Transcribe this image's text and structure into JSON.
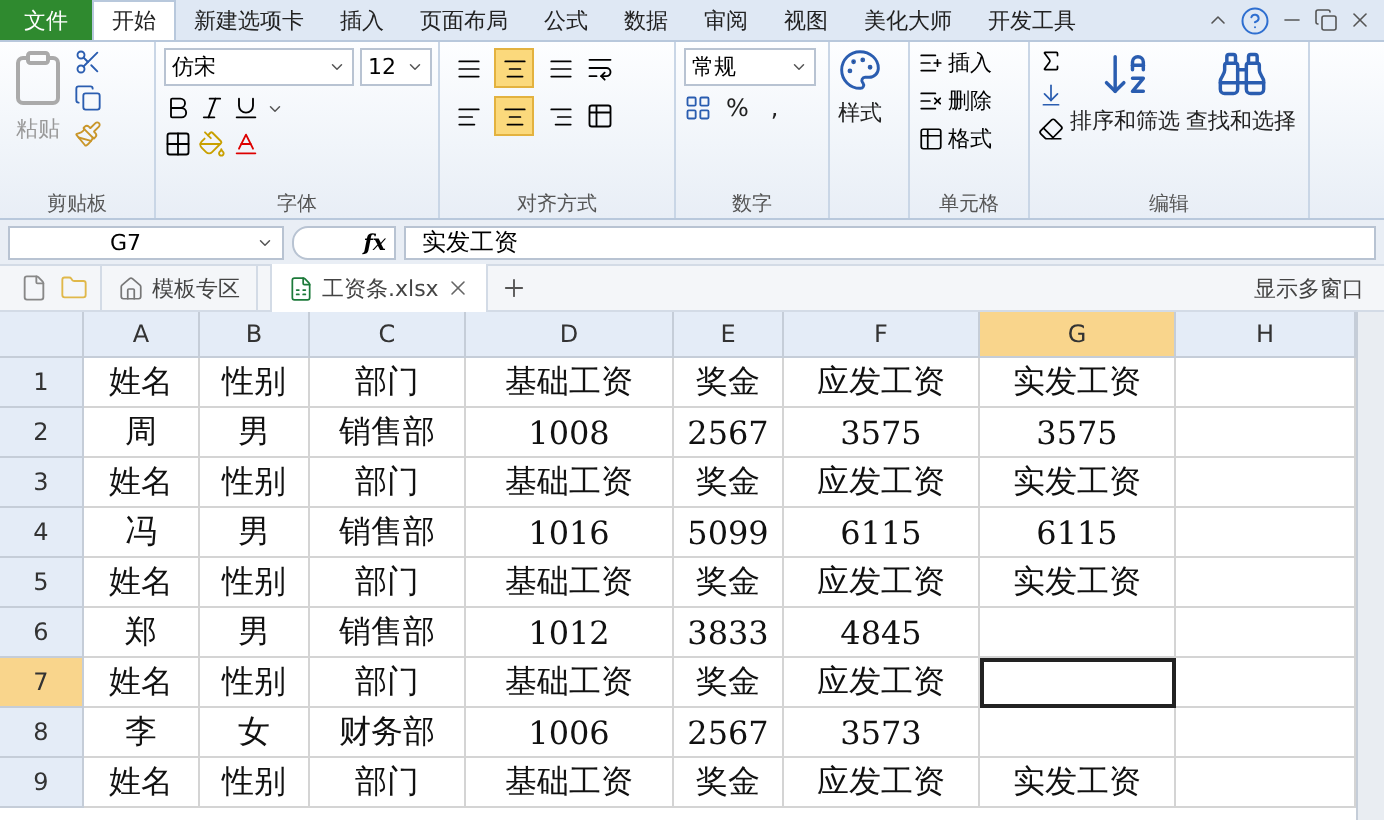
{
  "menu_tabs": [
    {
      "label": "文件",
      "kind": "file",
      "selected": false
    },
    {
      "label": "开始",
      "kind": "tab",
      "selected": true
    },
    {
      "label": "新建选项卡",
      "kind": "tab",
      "selected": false
    },
    {
      "label": "插入",
      "kind": "tab",
      "selected": false
    },
    {
      "label": "页面布局",
      "kind": "tab",
      "selected": false
    },
    {
      "label": "公式",
      "kind": "tab",
      "selected": false
    },
    {
      "label": "数据",
      "kind": "tab",
      "selected": false
    },
    {
      "label": "审阅",
      "kind": "tab",
      "selected": false
    },
    {
      "label": "视图",
      "kind": "tab",
      "selected": false
    },
    {
      "label": "美化大师",
      "kind": "tab",
      "selected": false
    },
    {
      "label": "开发工具",
      "kind": "tab",
      "selected": false
    }
  ],
  "ribbon": {
    "clipboard": {
      "label": "剪贴板",
      "paste": "粘贴"
    },
    "font": {
      "label": "字体",
      "family": "仿宋",
      "size": "12"
    },
    "alignment": {
      "label": "对齐方式",
      "vertical": [
        {
          "selected": false
        },
        {
          "selected": true
        },
        {
          "selected": false
        }
      ],
      "horizontal": [
        {
          "selected": false
        },
        {
          "selected": true
        },
        {
          "selected": false
        }
      ]
    },
    "number": {
      "label": "数字",
      "format": "常规",
      "percent": "%",
      "comma": ","
    },
    "styles": {
      "label": "样式"
    },
    "cells": {
      "label": "单元格",
      "items": [
        "插入",
        "删除",
        "格式"
      ]
    },
    "editing": {
      "label": "编辑",
      "sort": "排序和筛选",
      "find": "查找和选择"
    }
  },
  "formula_bar": {
    "name_box": "G7",
    "function_label": "fx",
    "formula": "实发工资"
  },
  "doc_tabs": [
    {
      "label": "模板专区",
      "kind": "home",
      "selected": false
    },
    {
      "label": "工资条.xlsx",
      "kind": "file",
      "selected": true
    }
  ],
  "multi_window": "显示多窗口",
  "sheet": {
    "columns": [
      {
        "label": "A",
        "selected": false
      },
      {
        "label": "B",
        "selected": false
      },
      {
        "label": "C",
        "selected": false
      },
      {
        "label": "D",
        "selected": false
      },
      {
        "label": "E",
        "selected": false
      },
      {
        "label": "F",
        "selected": false
      },
      {
        "label": "G",
        "selected": true
      },
      {
        "label": "H",
        "selected": false
      }
    ],
    "rows": [
      {
        "label": "1",
        "selected": false,
        "cells": [
          "姓名",
          "性别",
          "部门",
          "基础工资",
          "奖金",
          "应发工资",
          "实发工资"
        ]
      },
      {
        "label": "2",
        "selected": false,
        "cells": [
          "周",
          "男",
          "销售部",
          "1008",
          "2567",
          "3575",
          "3575"
        ]
      },
      {
        "label": "3",
        "selected": false,
        "cells": [
          "姓名",
          "性别",
          "部门",
          "基础工资",
          "奖金",
          "应发工资",
          "实发工资"
        ]
      },
      {
        "label": "4",
        "selected": false,
        "cells": [
          "冯",
          "男",
          "销售部",
          "1016",
          "5099",
          "6115",
          "6115"
        ]
      },
      {
        "label": "5",
        "selected": false,
        "cells": [
          "姓名",
          "性别",
          "部门",
          "基础工资",
          "奖金",
          "应发工资",
          "实发工资"
        ]
      },
      {
        "label": "6",
        "selected": false,
        "cells": [
          "郑",
          "男",
          "销售部",
          "1012",
          "3833",
          "4845"
        ]
      },
      {
        "label": "7",
        "selected": true,
        "cells": [
          "姓名",
          "性别",
          "部门",
          "基础工资",
          "奖金",
          "应发工资"
        ]
      },
      {
        "label": "8",
        "selected": false,
        "cells": [
          "李",
          "女",
          "财务部",
          "1006",
          "2567",
          "3573"
        ]
      },
      {
        "label": "9",
        "selected": false,
        "cells": [
          "姓名",
          "性别",
          "部门",
          "基础工资",
          "奖金",
          "应发工资",
          "实发工资"
        ]
      }
    ]
  }
}
